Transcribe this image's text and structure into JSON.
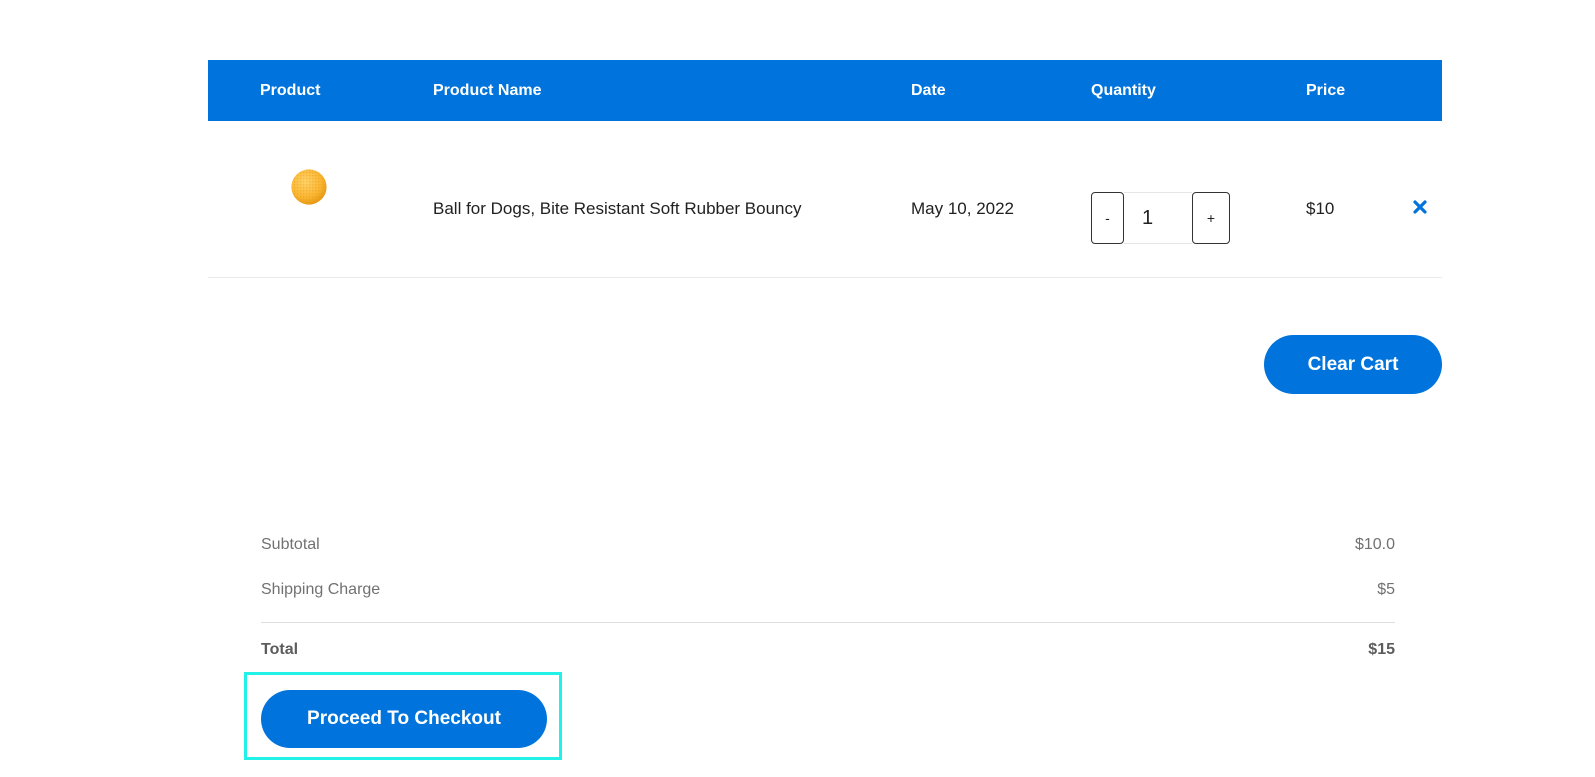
{
  "table": {
    "headers": {
      "product": "Product",
      "product_name": "Product Name",
      "date": "Date",
      "quantity": "Quantity",
      "price": "Price"
    },
    "items": [
      {
        "image_icon": "spiky-yellow-ball-image",
        "name": "Ball for Dogs, Bite Resistant Soft Rubber Bouncy",
        "date": "May 10, 2022",
        "quantity": "1",
        "price": "$10",
        "decrement_label": "-",
        "increment_label": "+",
        "remove_icon": "close-x-icon"
      }
    ]
  },
  "actions": {
    "clear_cart": "Clear Cart",
    "checkout": "Proceed To Checkout"
  },
  "summary": {
    "subtotal_label": "Subtotal",
    "subtotal_value": "$10.0",
    "shipping_label": "Shipping Charge",
    "shipping_value": "$5",
    "total_label": "Total",
    "total_value": "$15"
  },
  "colors": {
    "accent": "#0074dc",
    "highlight": "#21f1e6",
    "ball": "#f9b531"
  }
}
